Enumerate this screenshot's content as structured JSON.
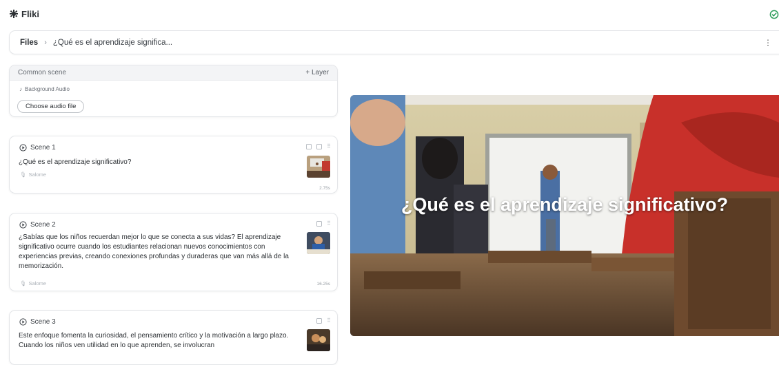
{
  "app": {
    "name": "Fliki"
  },
  "breadcrumb": {
    "root": "Files",
    "separator": "›",
    "current": "¿Qué es el aprendizaje significa..."
  },
  "common_scene": {
    "title": "Common scene",
    "layer_label": "+ Layer",
    "audio_label": "Background Audio",
    "choose_audio_label": "Choose audio file"
  },
  "scenes": [
    {
      "label": "Scene 1",
      "text": "¿Qué es el aprendizaje significativo?",
      "voice": "Salome",
      "duration": "2.75s"
    },
    {
      "label": "Scene 2",
      "text": "¿Sabías que los niños recuerdan mejor lo que se conecta a sus vidas? El aprendizaje significativo ocurre cuando los estudiantes relacionan nuevos conocimientos con experiencias previas, creando conexiones profundas y duraderas que van más allá de la memorización.",
      "voice": "Salome",
      "duration": "16.25s"
    },
    {
      "label": "Scene 3",
      "text": "Este enfoque fomenta la curiosidad, el pensamiento crítico y la motivación a largo plazo. Cuando los niños ven utilidad en lo que aprenden, se involucran"
    }
  ],
  "preview": {
    "caption": "¿Qué es el aprendizaje significativo?"
  },
  "colors": {
    "saved": "#2e9e5b",
    "border": "#e3e5e8",
    "header_bg": "#f3f4f6"
  }
}
